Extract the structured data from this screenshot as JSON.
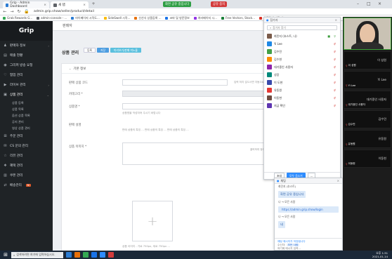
{
  "browser": {
    "tabs": [
      {
        "label": "Grip - Admin Dashboard"
      },
      {
        "label": "새 탭"
      }
    ],
    "recording_pills": [
      {
        "label": "화면 공유 중입니다",
        "color": "#2e9e44"
      },
      {
        "label": "공유 중지",
        "color": "#d33b3b"
      }
    ],
    "url": "admin.grip.show/seller/product/detail",
    "bookmarks": [
      {
        "label": "Grab Rewards G...",
        "color": "#34a853"
      },
      {
        "label": "admin-console - ...",
        "color": "#5f6368"
      },
      {
        "label": "마이페이지 시작도...",
        "color": "#2b7cd3"
      },
      {
        "label": "SideSwell 시작...",
        "color": "#fbbc04"
      },
      {
        "label": "신선식 상품등록 ...",
        "color": "#e8710a"
      },
      {
        "label": "코바 및 방문정보",
        "color": "#1a73e8"
      },
      {
        "label": "여러페이지 시...",
        "color": "#9334e6"
      },
      {
        "label": "Free Vectors, Stock...",
        "color": "#188038"
      },
      {
        "label": "아름답게 지금 바...",
        "color": "#d93025"
      }
    ]
  },
  "sidebar": {
    "logo": "Grip",
    "items": [
      {
        "label": "판매자 정보",
        "icon": "user-icon",
        "caret": true
      },
      {
        "label": "매출 현황",
        "icon": "chart-icon",
        "caret": false
      },
      {
        "label": "그리퍼 방송 요청",
        "icon": "broadcast-icon",
        "caret": false
      },
      {
        "label": "협업 관리",
        "icon": "handshake-icon",
        "caret": false
      },
      {
        "label": "라이브 관리",
        "icon": "live-icon",
        "caret": true
      },
      {
        "label": "상품 관리",
        "icon": "box-icon",
        "caret": true,
        "open": true
      }
    ],
    "submenu": [
      {
        "label": "상품 등록"
      },
      {
        "label": "상품 목록"
      },
      {
        "label": "옵션 상품 목록"
      },
      {
        "label": "공지 관리"
      },
      {
        "label": "영상 상품 관리"
      }
    ],
    "items_after": [
      {
        "label": "주문 관리",
        "icon": "cart-icon",
        "caret": false
      },
      {
        "label": "CS 문의 관리",
        "icon": "chat-icon",
        "caret": false
      },
      {
        "label": "리뷰 관리",
        "icon": "star-icon",
        "caret": false
      },
      {
        "label": "혜택 관리",
        "icon": "gift-icon",
        "caret": false
      },
      {
        "label": "쿠폰 관리",
        "icon": "coupon-icon",
        "caret": false
      },
      {
        "label": "배송관리",
        "icon": "truck-icon",
        "caret": false,
        "badge": "N"
      }
    ]
  },
  "main": {
    "topbar_title": "판매자",
    "section_title": "상품 관리",
    "section_buttons": [
      {
        "label": "등록",
        "style": "plain"
      },
      {
        "label": "저장",
        "style": "blue"
      },
      {
        "label": "미리보기/판매 미노출",
        "style": "teal"
      }
    ],
    "card_header": "기본 정보",
    "fields": [
      {
        "label": "판매 상품 코드",
        "help_right": "입력 하지 않으시면 자동으로 생성됩니다"
      },
      {
        "label": "카테고리 *"
      },
      {
        "label": "상품명 *",
        "help": "상품명을 작성하여 주시기 바랍니다"
      },
      {
        "label": "판매 설명",
        "help": "판매 상품의 특징 ...  판매 상품의 특징 ...  판매 상품의 특징 ..."
      },
      {
        "label": "상품 이미지 *",
        "help_right": "클릭하여 등록"
      },
      {
        "label": "",
        "help": "상품 이미지 - 가로 750px, 세로 750px ..."
      }
    ],
    "upload_plus": "+"
  },
  "zoom_participants": {
    "title": "참가자",
    "search_placeholder": "참가자 찾기",
    "participants": [
      {
        "name": "최민지 (호스트, 나)",
        "color": "#7a5b4a",
        "host": true
      },
      {
        "name": "Yi Lee",
        "color": "#1e88e5"
      },
      {
        "name": "김수민",
        "color": "#43a047"
      },
      {
        "name": "김수현",
        "color": "#fb8c00"
      },
      {
        "name": "대기중인 사용자",
        "color": "#8e24aa"
      },
      {
        "name": "성장",
        "color": "#00897b"
      },
      {
        "name": "이 도현",
        "color": "#3949ab"
      },
      {
        "name": "유동원",
        "color": "#e53935"
      },
      {
        "name": "이동현",
        "color": "#6d4c41"
      },
      {
        "name": "지금 확인",
        "color": "#5e35b1"
      }
    ],
    "footer_buttons": [
      {
        "label": "초대",
        "style": "plain"
      },
      {
        "label": "모두 음소거",
        "style": "blue"
      },
      {
        "label": "...",
        "style": "plain"
      }
    ]
  },
  "zoom_chat": {
    "title": "채팅",
    "messages": [
      {
        "type": "sender",
        "text": "최민지 (호스트)"
      },
      {
        "type": "bubble",
        "text": "화면 공유 중입니다"
      },
      {
        "type": "sender",
        "text": "나 → 모든 사람"
      },
      {
        "type": "link",
        "text": "https://admin.grip.show/login"
      },
      {
        "type": "sender",
        "text": "나 → 모든 사람"
      },
      {
        "type": "bubble",
        "text": "네"
      }
    ],
    "notice": "채팅 메시지가 저장됩니다",
    "to_label": "수신자:",
    "to_value": "모든 사람",
    "input_placeholder": "여기에 메시지 입력..."
  },
  "zoom_gallery": {
    "tiles": [
      {
        "name": "이 성원",
        "tag": "이 성원"
      },
      {
        "name": "Yi Lee",
        "tag": "Yi Lee"
      },
      {
        "name": "대기중인 사용자",
        "tag": "대기중인 사용자"
      },
      {
        "name": "김수민",
        "tag": "김수민"
      },
      {
        "name": "유동원",
        "tag": "유동원"
      },
      {
        "name": "이동현",
        "tag": "이동현"
      }
    ]
  },
  "taskbar": {
    "search_placeholder": "검색하려면 여기에 입력하십시오.",
    "apps": [
      "#2b7cd3",
      "#e8710a",
      "#34a853",
      "#1a73e8",
      "#2d8cff",
      "#d33b3b"
    ],
    "time": "오후 1:31",
    "date": "2021-01-14"
  }
}
